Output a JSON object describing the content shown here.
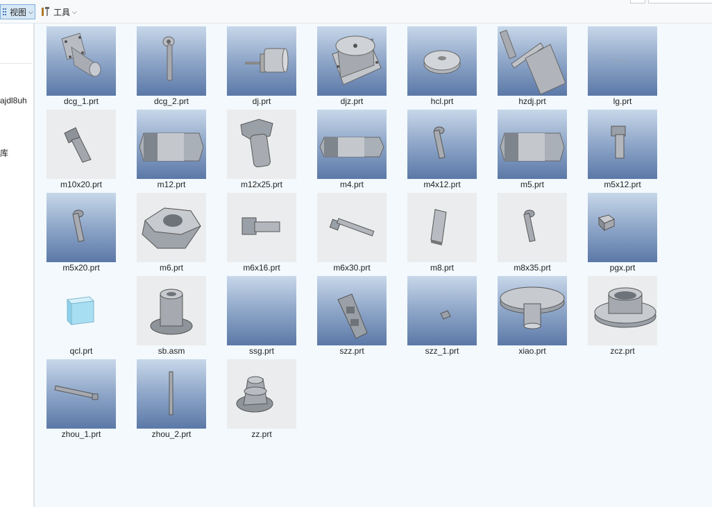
{
  "toolbar": {
    "view_label": "视图",
    "tools_label": "工具"
  },
  "sidebar": {
    "items": [
      "ajdl8uh",
      "库"
    ]
  },
  "files": [
    {
      "name": "dcg_1.prt",
      "bg": "blue",
      "shape": "dcg1"
    },
    {
      "name": "dcg_2.prt",
      "bg": "blue",
      "shape": "dcg2"
    },
    {
      "name": "dj.prt",
      "bg": "blue",
      "shape": "dj"
    },
    {
      "name": "djz.prt",
      "bg": "blue",
      "shape": "djz"
    },
    {
      "name": "hcl.prt",
      "bg": "blue",
      "shape": "hcl"
    },
    {
      "name": "hzdj.prt",
      "bg": "blue",
      "shape": "hzdj"
    },
    {
      "name": "lg.prt",
      "bg": "blue",
      "shape": "lg"
    },
    {
      "name": "m10x20.prt",
      "bg": "gray",
      "shape": "bolt-tilt"
    },
    {
      "name": "m12.prt",
      "bg": "blue",
      "shape": "nut-side"
    },
    {
      "name": "m12x25.prt",
      "bg": "gray",
      "shape": "hexbolt"
    },
    {
      "name": "m4.prt",
      "bg": "blue",
      "shape": "nut-side-thin"
    },
    {
      "name": "m4x12.prt",
      "bg": "blue",
      "shape": "screw-small"
    },
    {
      "name": "m5.prt",
      "bg": "blue",
      "shape": "nut-side"
    },
    {
      "name": "m5x12.prt",
      "bg": "blue",
      "shape": "bolt-short"
    },
    {
      "name": "m5x20.prt",
      "bg": "blue",
      "shape": "screw-small"
    },
    {
      "name": "m6.prt",
      "bg": "gray",
      "shape": "nut-iso"
    },
    {
      "name": "m6x16.prt",
      "bg": "gray",
      "shape": "bolt-horiz"
    },
    {
      "name": "m6x30.prt",
      "bg": "gray",
      "shape": "screw-long"
    },
    {
      "name": "m8.prt",
      "bg": "gray",
      "shape": "block"
    },
    {
      "name": "m8x35.prt",
      "bg": "gray",
      "shape": "screw-small"
    },
    {
      "name": "pgx.prt",
      "bg": "blue",
      "shape": "cube-small"
    },
    {
      "name": "qcl.prt",
      "bg": "none",
      "shape": "cube-blue"
    },
    {
      "name": "sb.asm",
      "bg": "gray",
      "shape": "sb"
    },
    {
      "name": "ssg.prt",
      "bg": "blue",
      "shape": "empty"
    },
    {
      "name": "szz.prt",
      "bg": "blue",
      "shape": "szz"
    },
    {
      "name": "szz_1.prt",
      "bg": "blue",
      "shape": "tiny"
    },
    {
      "name": "xiao.prt",
      "bg": "blue",
      "shape": "xiao"
    },
    {
      "name": "zcz.prt",
      "bg": "gray",
      "shape": "zcz"
    },
    {
      "name": "zhou_1.prt",
      "bg": "blue",
      "shape": "shaft"
    },
    {
      "name": "zhou_2.prt",
      "bg": "blue",
      "shape": "shaft-v"
    },
    {
      "name": "zz.prt",
      "bg": "gray",
      "shape": "zz"
    }
  ]
}
